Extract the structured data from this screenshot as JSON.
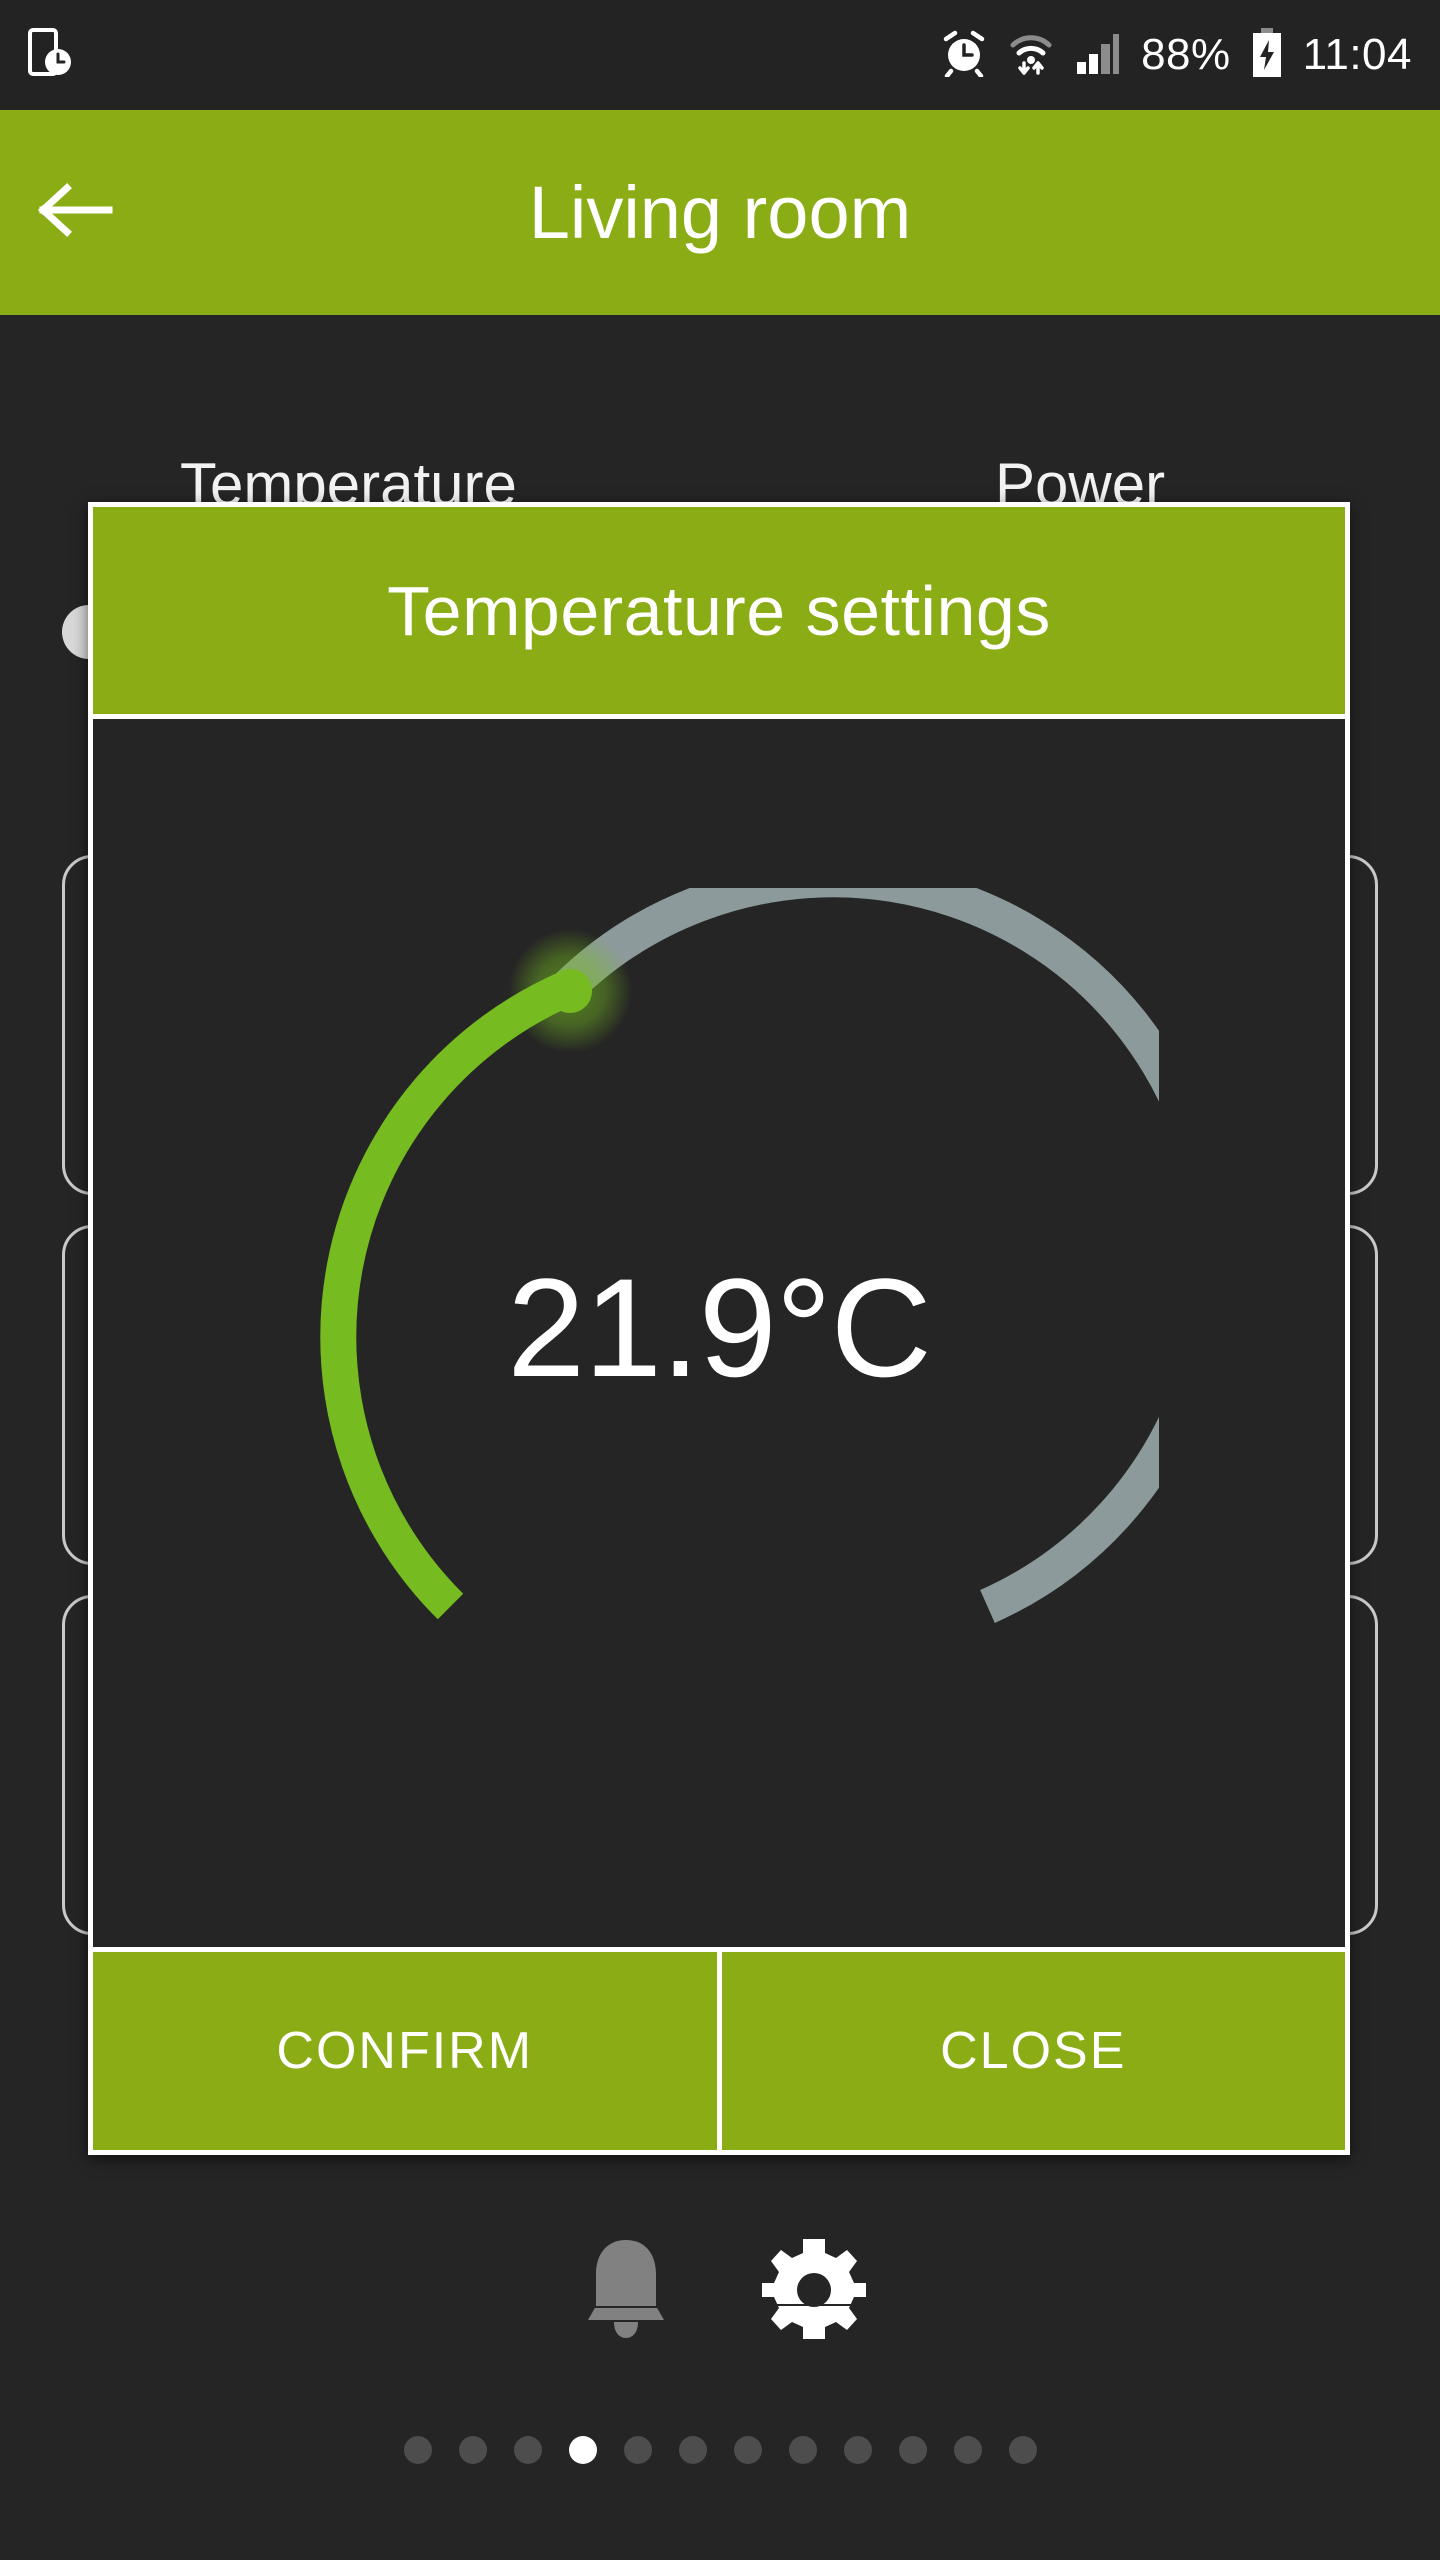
{
  "status_bar": {
    "left_icon": "device-clock-icon",
    "alarm_icon": "alarm-icon",
    "wifi_icon": "wifi-transfer-icon",
    "signal_icon": "cellular-signal-icon",
    "battery_percent": "88%",
    "battery_icon": "battery-charging-icon",
    "time": "11:04"
  },
  "app_bar": {
    "back_icon": "back-arrow-icon",
    "title": "Living room",
    "background_color": "#8aac14"
  },
  "background": {
    "column_labels": [
      "Temperature",
      "Power"
    ],
    "cards_per_column": 3
  },
  "dialog": {
    "title": "Temperature settings",
    "header_color": "#8aac14",
    "border_color": "#ffffff",
    "body_color": "#252525",
    "gauge": {
      "value_label": "21.9°C",
      "value": 21.9,
      "unit": "°C",
      "track_color": "#8d9a9b",
      "progress_color": "#76bc21",
      "thumb_color": "#76bc21",
      "thumb_glow_color": "rgba(118,188,33,0.42)"
    },
    "buttons": [
      {
        "label": "CONFIRM",
        "name": "confirm-button"
      },
      {
        "label": "CLOSE",
        "name": "close-button"
      }
    ]
  },
  "bottom_nav": {
    "items": [
      {
        "name": "notifications-bell-icon",
        "active": false,
        "color": "#818181"
      },
      {
        "name": "settings-gear-icon",
        "active": true,
        "color": "#ffffff"
      }
    ]
  },
  "page_dots": {
    "count": 12,
    "active_index": 3,
    "active_color": "#ffffff",
    "inactive_color": "#4d4d4d"
  }
}
